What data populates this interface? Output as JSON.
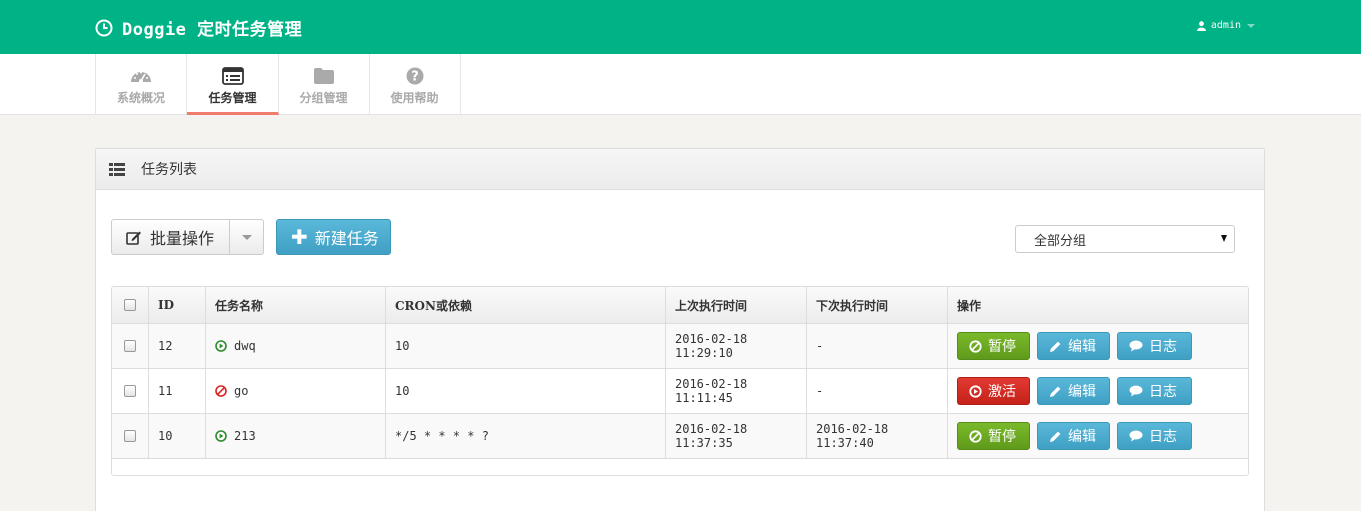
{
  "header": {
    "title": "Doggie 定时任务管理",
    "user": "admin",
    "brand_color": "#00b386"
  },
  "nav": {
    "items": [
      {
        "label": "系统概况",
        "icon": "dashboard-icon"
      },
      {
        "label": "任务管理",
        "icon": "list-icon",
        "active": true
      },
      {
        "label": "分组管理",
        "icon": "folder-icon"
      },
      {
        "label": "使用帮助",
        "icon": "help-icon"
      }
    ]
  },
  "panel": {
    "title": "任务列表",
    "batch_label": "批量操作",
    "new_label": "新建任务",
    "group_select": "全部分组"
  },
  "table": {
    "headers": {
      "id": "ID",
      "name": "任务名称",
      "cron": "CRON或依赖",
      "last": "上次执行时间",
      "next": "下次执行时间",
      "ops": "操作"
    },
    "rows": [
      {
        "id": "12",
        "status": "running",
        "name": "dwq",
        "cron": "10",
        "last": "2016-02-18 11:29:10",
        "next": "-",
        "toggle": "暂停",
        "edit": "编辑",
        "log": "日志"
      },
      {
        "id": "11",
        "status": "stopped",
        "name": "go",
        "cron": "10",
        "last": "2016-02-18 11:11:45",
        "next": "-",
        "toggle": "激活",
        "edit": "编辑",
        "log": "日志"
      },
      {
        "id": "10",
        "status": "running",
        "name": "213",
        "cron": "*/5 * * * * ?",
        "last": "2016-02-18 11:37:35",
        "next": "2016-02-18 11:37:40",
        "toggle": "暂停",
        "edit": "编辑",
        "log": "日志"
      }
    ]
  }
}
